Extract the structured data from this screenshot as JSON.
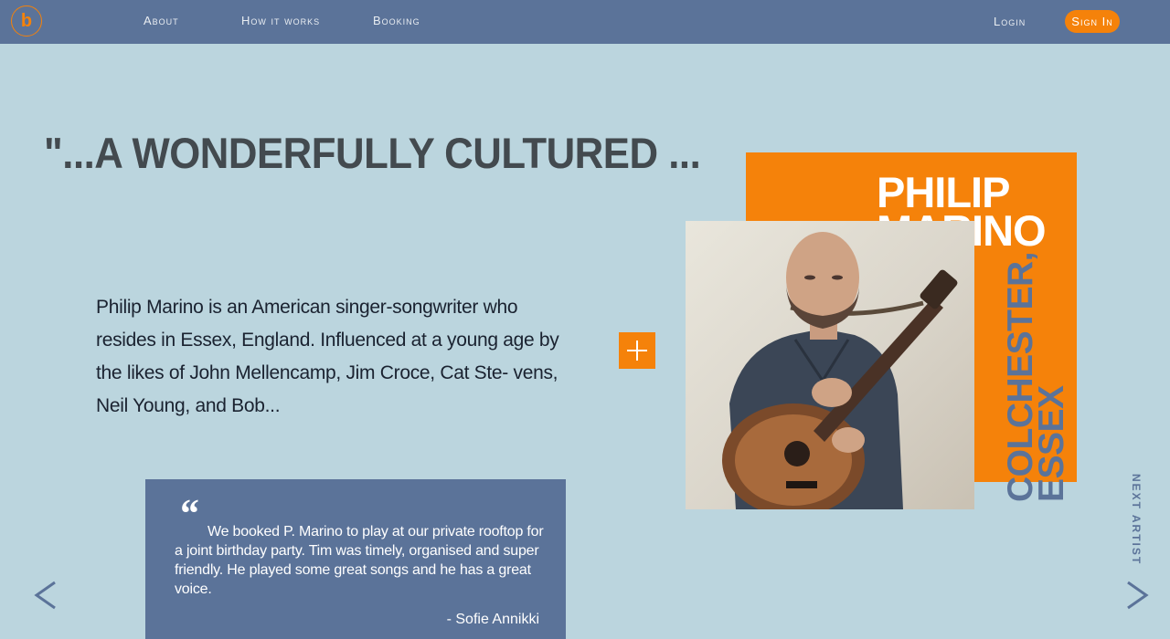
{
  "nav": {
    "logo_letter": "b",
    "about": "About",
    "how_it_works": "How it works",
    "booking": "Booking",
    "login": "Login",
    "sign_in": "Sign In"
  },
  "hero": {
    "headline": "\"...A WONDERFULLY CULTURED ...",
    "bio": "Philip Marino is an American singer-songwriter who resides in Essex, England. Influenced at a young age by the likes of John Mellencamp, Jim Croce, Cat Ste- vens, Neil Young, and Bob..."
  },
  "artist": {
    "first_name": "PHILIP",
    "last_name": "MARINO",
    "location_line1": "COLCHESTER,",
    "location_line2": "ESSEX",
    "photo_icon": "artist-photo"
  },
  "testimonial": {
    "quote_mark": "“",
    "text": "We booked P. Marino to play at our private rooftop for a joint birthday party. Tim was timely, organised and super friendly. He played some great songs and he has a great voice.",
    "author": "- Sofie Annikki"
  },
  "navigation": {
    "next_artist": "NEXT ARTIST",
    "prev_icon": "chevron-left-icon",
    "next_icon": "chevron-right-icon"
  },
  "colors": {
    "accent": "#f5820a",
    "nav_bg": "#5b7399",
    "page_bg": "#bbd5de",
    "headline": "#434a4f"
  }
}
